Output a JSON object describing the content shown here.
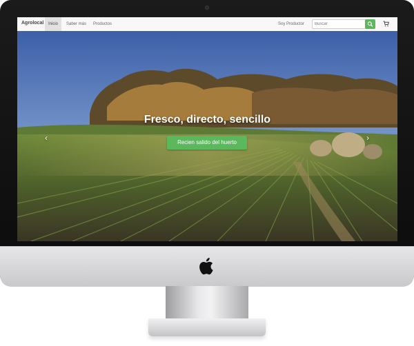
{
  "navbar": {
    "brand": "Agrolocal",
    "items": [
      {
        "label": "Inicio",
        "active": true
      },
      {
        "label": "Saber más",
        "active": false
      },
      {
        "label": "Productos",
        "active": false
      }
    ],
    "producer_link": "Soy Productor",
    "search": {
      "placeholder": "Buscar",
      "button_icon": "search-icon"
    },
    "cart_icon": "cart-icon"
  },
  "hero": {
    "headline": "Fresco, directo, sencillo",
    "cta_label": "Recien salido del huerto",
    "prev_icon": "chevron-left-icon",
    "next_icon": "chevron-right-icon",
    "slides_count": 3,
    "active_slide": 1
  },
  "colors": {
    "accent": "#5cb85c",
    "navbar_bg": "#f8f8f8"
  }
}
